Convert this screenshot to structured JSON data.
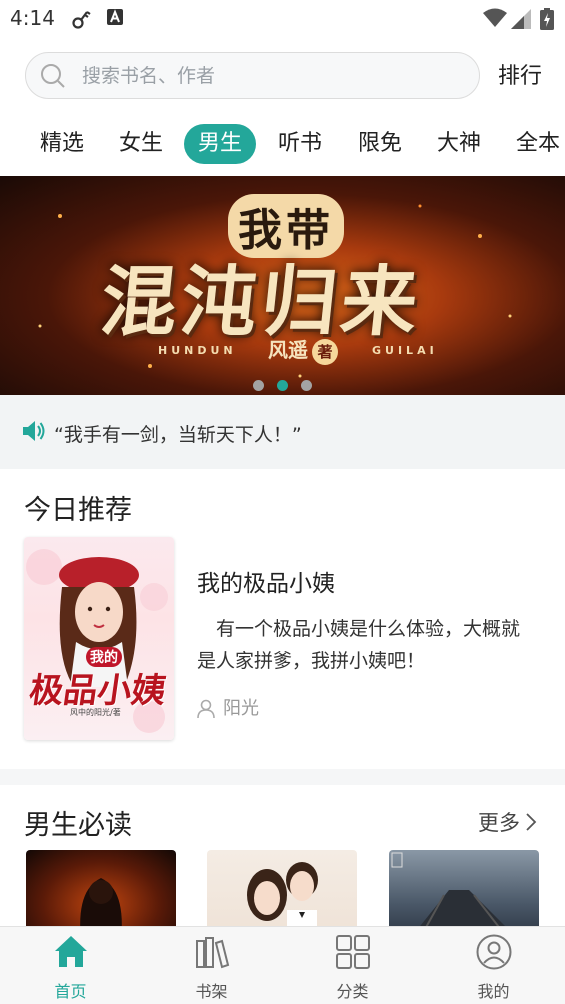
{
  "status_bar": {
    "time": "4:14"
  },
  "search": {
    "placeholder": "搜索书名、作者",
    "rank_label": "排行"
  },
  "tabs": [
    {
      "label": "精选"
    },
    {
      "label": "女生"
    },
    {
      "label": "男生",
      "active": true
    },
    {
      "label": "听书"
    },
    {
      "label": "限免"
    },
    {
      "label": "大神"
    },
    {
      "label": "全本"
    }
  ],
  "banner": {
    "title_small": "我带",
    "title_big": "混沌归来",
    "sub_left": "HUNDUN",
    "sub_right": "GUILAI",
    "author": "风遥",
    "author_mark": "著",
    "active_dot": 1,
    "dot_count": 3
  },
  "notice": {
    "text": "“我手有一剑，当斩天下人！”"
  },
  "today": {
    "section_title": "今日推荐",
    "book": {
      "title": "我的极品小姨",
      "description": "有一个极品小姨是什么体验，大概就是人家拼爹，我拼小姨吧！",
      "author": "阳光",
      "cover_title_small": "我的",
      "cover_title_big": "极品小姨",
      "cover_author": "风中的阳光/著"
    }
  },
  "must_read": {
    "section_title": "男生必读",
    "more_label": "更多"
  },
  "bottom_nav": [
    {
      "label": "首页",
      "icon": "home-icon",
      "active": true
    },
    {
      "label": "书架",
      "icon": "bookshelf-icon"
    },
    {
      "label": "分类",
      "icon": "category-icon"
    },
    {
      "label": "我的",
      "icon": "profile-icon"
    }
  ],
  "colors": {
    "accent": "#23a79a"
  }
}
